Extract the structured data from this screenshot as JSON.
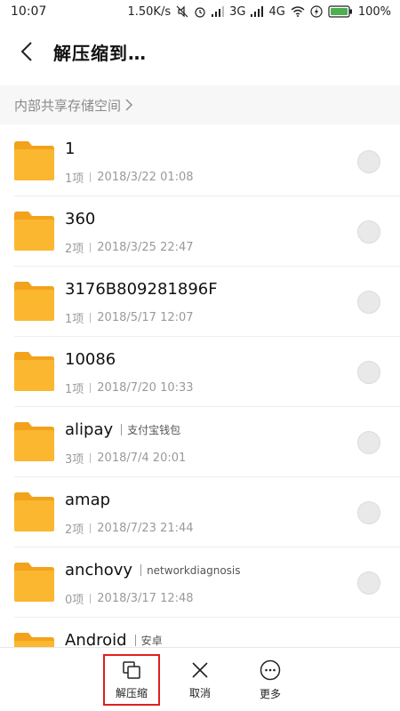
{
  "status_bar": {
    "time": "10:07",
    "speed": "1.50K/s",
    "net1": "3G",
    "net2": "4G",
    "battery": "100%"
  },
  "header": {
    "title": "解压缩到…"
  },
  "breadcrumb": {
    "path": "内部共享存储空间"
  },
  "folders": [
    {
      "name": "1",
      "tag": "",
      "count": "1项",
      "date": "2018/3/22 01:08"
    },
    {
      "name": "360",
      "tag": "",
      "count": "2项",
      "date": "2018/3/25 22:47"
    },
    {
      "name": "3176B809281896F",
      "tag": "",
      "count": "1项",
      "date": "2018/5/17 12:07"
    },
    {
      "name": "10086",
      "tag": "",
      "count": "1项",
      "date": "2018/7/20 10:33"
    },
    {
      "name": "alipay",
      "tag": "支付宝钱包",
      "count": "3项",
      "date": "2018/7/4 20:01"
    },
    {
      "name": "amap",
      "tag": "",
      "count": "2项",
      "date": "2018/7/23 21:44"
    },
    {
      "name": "anchovy",
      "tag": "networkdiagnosis",
      "count": "0项",
      "date": "2018/3/17 12:48"
    },
    {
      "name": "Android",
      "tag": "安卓",
      "count": "",
      "date": ""
    }
  ],
  "bottom_bar": {
    "extract_label": "解压缩",
    "cancel_label": "取消",
    "more_label": "更多"
  },
  "colors": {
    "folder": "#fbb72f",
    "folder_tab": "#f3a21b",
    "highlight": "#e02020"
  }
}
